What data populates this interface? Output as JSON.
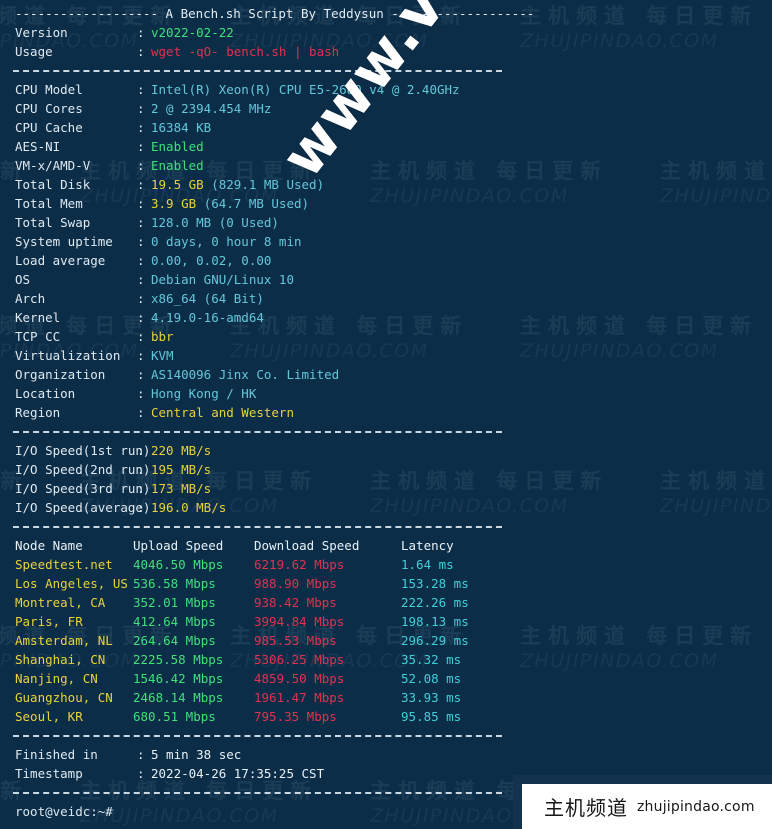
{
  "terminal": {
    "title_line": "------------------- A Bench.sh Script By Teddysun -------------------",
    "header": {
      "version_label": "Version",
      "version_value": "v2022-02-22",
      "usage_label": "Usage",
      "usage_value": "wget -qO- bench.sh | bash"
    },
    "sysinfo": [
      {
        "label": "CPU Model",
        "value": "Intel(R) Xeon(R) CPU E5-2680 v4 @ 2.40GHz",
        "color": "ltcyan"
      },
      {
        "label": "CPU Cores",
        "value": "2 @ 2394.454 MHz",
        "color": "ltcyan"
      },
      {
        "label": "CPU Cache",
        "value": "16384 KB",
        "color": "ltcyan"
      },
      {
        "label": "AES-NI",
        "value": "Enabled",
        "color": "green"
      },
      {
        "label": "VM-x/AMD-V",
        "value": "Enabled",
        "color": "green"
      },
      {
        "label": "Total Disk",
        "value": "19.5 GB (829.1 MB Used)",
        "color": "split-yellow"
      },
      {
        "label": "Total Mem",
        "value": "3.9 GB (64.7 MB Used)",
        "color": "split-yellow"
      },
      {
        "label": "Total Swap",
        "value": "128.0 MB (0 Used)",
        "color": "ltcyan"
      },
      {
        "label": "System uptime",
        "value": "0 days, 0 hour 8 min",
        "color": "ltcyan"
      },
      {
        "label": "Load average",
        "value": "0.00, 0.02, 0.00",
        "color": "ltcyan"
      },
      {
        "label": "OS",
        "value": "Debian GNU/Linux 10",
        "color": "ltcyan"
      },
      {
        "label": "Arch",
        "value": "x86_64 (64 Bit)",
        "color": "ltcyan"
      },
      {
        "label": "Kernel",
        "value": "4.19.0-16-amd64",
        "color": "ltcyan"
      },
      {
        "label": "TCP CC",
        "value": "bbr",
        "color": "yellow"
      },
      {
        "label": "Virtualization",
        "value": "KVM",
        "color": "ltcyan"
      },
      {
        "label": "Organization",
        "value": "AS140096 Jinx Co. Limited",
        "color": "ltcyan"
      },
      {
        "label": "Location",
        "value": "Hong Kong / HK",
        "color": "ltcyan"
      },
      {
        "label": "Region",
        "value": "Central and Western",
        "color": "yellow"
      }
    ],
    "io_speed": [
      {
        "label": "I/O Speed(1st run)",
        "value": "220 MB/s"
      },
      {
        "label": "I/O Speed(2nd run)",
        "value": "195 MB/s"
      },
      {
        "label": "I/O Speed(3rd run)",
        "value": "173 MB/s"
      },
      {
        "label": "I/O Speed(average)",
        "value": "196.0 MB/s"
      }
    ],
    "speedtest": {
      "columns": [
        "Node Name",
        "Upload Speed",
        "Download Speed",
        "Latency"
      ],
      "rows": [
        {
          "node": "Speedtest.net",
          "upload": "4046.50 Mbps",
          "download": "6219.62 Mbps",
          "latency": "1.64 ms"
        },
        {
          "node": "Los Angeles, US",
          "upload": "536.58 Mbps",
          "download": "988.90 Mbps",
          "latency": "153.28 ms"
        },
        {
          "node": "Montreal, CA",
          "upload": "352.01 Mbps",
          "download": "938.42 Mbps",
          "latency": "222.26 ms"
        },
        {
          "node": "Paris, FR",
          "upload": "412.64 Mbps",
          "download": "3994.84 Mbps",
          "latency": "198.13 ms"
        },
        {
          "node": "Amsterdam, NL",
          "upload": "264.64 Mbps",
          "download": "985.53 Mbps",
          "latency": "296.29 ms"
        },
        {
          "node": "Shanghai, CN",
          "upload": "2225.58 Mbps",
          "download": "5306.25 Mbps",
          "latency": "35.32 ms"
        },
        {
          "node": "Nanjing, CN",
          "upload": "1546.42 Mbps",
          "download": "4859.50 Mbps",
          "latency": "52.08 ms"
        },
        {
          "node": "Guangzhou, CN",
          "upload": "2468.14 Mbps",
          "download": "1961.47 Mbps",
          "latency": "33.93 ms"
        },
        {
          "node": "Seoul, KR",
          "upload": "680.51 Mbps",
          "download": "795.35 Mbps",
          "latency": "95.85 ms"
        }
      ]
    },
    "footer": {
      "finished_label": "Finished in",
      "finished_value": "5 min 38 sec",
      "timestamp_label": "Timestamp",
      "timestamp_value": "2022-04-26 17:35:25 CST"
    },
    "prompt": "root@veidc:~#"
  },
  "watermark": {
    "diagonal_text": "www.veidc.com",
    "tile_cn": "主机频道 每日更新",
    "tile_en": "ZHUJIPINDAO.COM"
  },
  "badge": {
    "cn_text": "主机频道",
    "en_text": "zhujipindao.com"
  },
  "colors": {
    "background": "#0c2d48",
    "green": "#3ee07a",
    "red": "#e0314f",
    "cyan": "#3fd0d8",
    "yellow": "#e8d23a",
    "white": "#e8f1f6"
  }
}
